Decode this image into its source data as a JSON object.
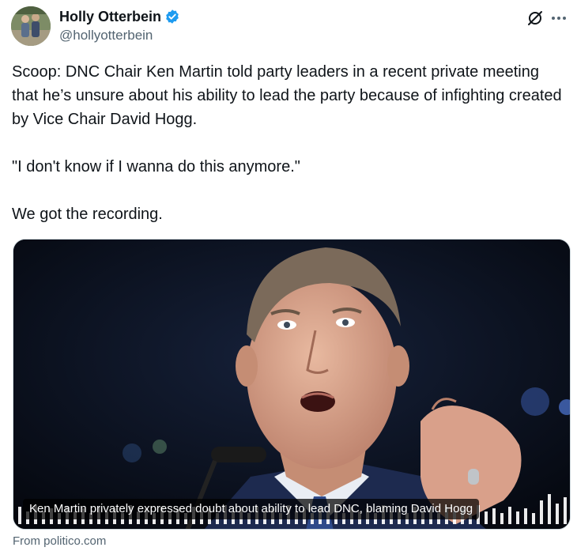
{
  "author": {
    "display_name": "Holly Otterbein",
    "handle": "@hollyotterbein",
    "verified_icon": "verified-badge-icon",
    "verified_color": "#1d9bf0"
  },
  "actions": {
    "grok_icon": "grok-icon",
    "more_icon": "more-horizontal-icon"
  },
  "tweet": {
    "paragraphs": [
      "Scoop: DNC Chair Ken Martin told party leaders in a recent private meeting that he’s unsure about his ability to lead the party because of infighting created by Vice Chair David Hogg.",
      "\"I don't know if I wanna do this anymore.\"",
      "We got the recording."
    ]
  },
  "link_card": {
    "caption": "Ken Martin privately expressed doubt about ability to lead DNC, blaming David Hogg",
    "source": "From politico.com"
  }
}
